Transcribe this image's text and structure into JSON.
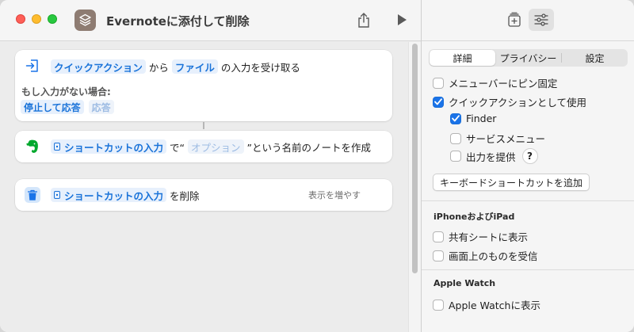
{
  "window": {
    "title": "Evernoteに添付して削除"
  },
  "actions": [
    {
      "tokens": [
        "クイックアクション",
        "ファイル"
      ],
      "words": [
        "から",
        "の入力を受け取る"
      ],
      "no_input_label": "もし入力がない場合:",
      "fallback_tokens": [
        "停止して応答",
        "応答"
      ]
    },
    {
      "token": "ショートカットの入力",
      "word_de": "で“",
      "placeholder_token": "オプション",
      "tail": "”という名前のノートを作成"
    },
    {
      "token": "ショートカットの入力",
      "tail": "を削除",
      "more": "表示を増やす"
    }
  ],
  "inspector": {
    "tabs": [
      "詳細",
      "プライバシー",
      "設定"
    ],
    "options": [
      {
        "label": "メニューバーにピン固定",
        "checked": false
      },
      {
        "label": "クイックアクションとして使用",
        "checked": true
      },
      {
        "label": "Finder",
        "checked": true
      },
      {
        "label": "サービスメニュー",
        "checked": false
      },
      {
        "label": "出力を提供",
        "checked": false
      }
    ],
    "help_label": "?",
    "shortcut_button": "キーボードショートカットを追加",
    "iphone_section": {
      "title": "iPhoneおよびiPad",
      "options": [
        {
          "label": "共有シートに表示",
          "checked": false
        },
        {
          "label": "画面上のものを受信",
          "checked": false
        }
      ]
    },
    "watch_section": {
      "title": "Apple Watch",
      "options": [
        {
          "label": "Apple Watchに表示",
          "checked": false
        }
      ]
    }
  },
  "colors": {
    "accent": "#1a73e8",
    "token_text": "#1a73d9",
    "evernote_green": "#00a82d"
  }
}
